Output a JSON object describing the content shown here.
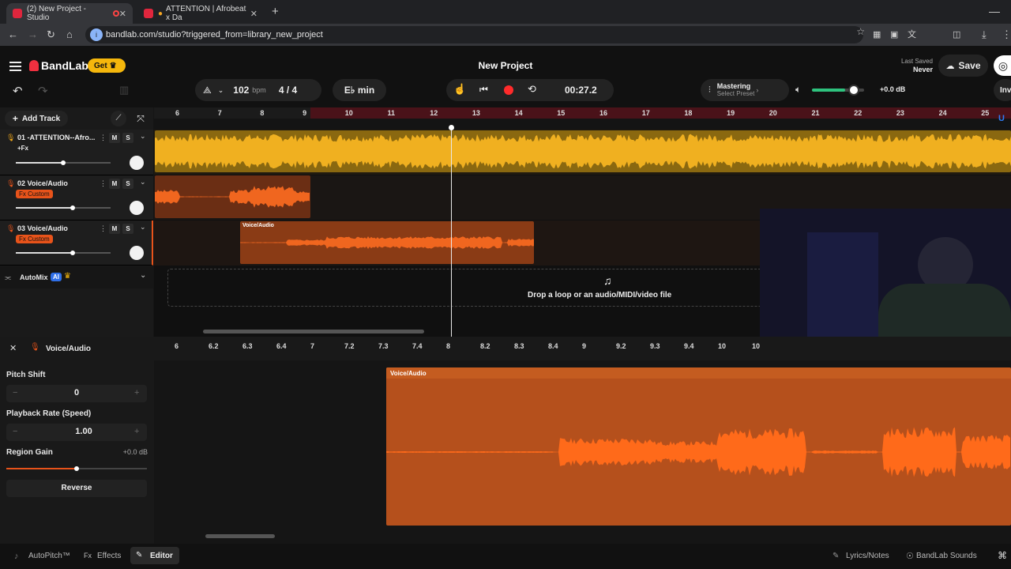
{
  "browser": {
    "tabs": [
      {
        "title": "(2) New Project - Studio",
        "active": true
      },
      {
        "title": "ATTENTION | Afrobeat x Da",
        "active": false
      }
    ],
    "new_tab": "+",
    "url": "bandlab.com/studio?triggered_from=library_new_project"
  },
  "app": {
    "brand": "BandLab",
    "get_label": "Get",
    "project_title": "New Project",
    "last_saved_label": "Last Saved",
    "last_saved_value": "Never",
    "save_label": "Save"
  },
  "transport": {
    "bpm_value": "102",
    "bpm_unit": "bpm",
    "time_signature": "4 / 4",
    "key": "E♭ min",
    "time": "00:27.2",
    "mastering_label": "Mastering",
    "mastering_preset": "Select Preset",
    "volume_db": "+0.0 dB",
    "volume_level": 0.8,
    "invite_label": "Inv"
  },
  "add_track_label": "Add Track",
  "ruler_ticks": [
    "6",
    "7",
    "8",
    "9",
    "10",
    "11",
    "12",
    "13",
    "14",
    "15",
    "16",
    "17",
    "18",
    "19",
    "20",
    "21",
    "22",
    "23",
    "24",
    "25"
  ],
  "tracks": [
    {
      "name": "01 -ATTENTION--Afro...",
      "fx": "+Fx",
      "fx_custom": false,
      "color": "#f0a81a",
      "volume": 0.5
    },
    {
      "name": "02 Voice/Audio",
      "fx": "Fx Custom",
      "fx_custom": true,
      "color": "#e8531a",
      "volume": 0.6
    },
    {
      "name": "03 Voice/Audio",
      "fx": "Fx Custom",
      "fx_custom": true,
      "color": "#e8531a",
      "volume": 0.6
    }
  ],
  "mute_label": "M",
  "solo_label": "S",
  "clip_label": "Voice/Audio",
  "automix_label": "AutoMix",
  "ai_badge": "AI",
  "drop_text": "Drop a loop or an audio/MIDI/video file",
  "editor": {
    "track_name": "Voice/Audio",
    "ruler_ticks": [
      "6",
      "6.2",
      "6.3",
      "6.4",
      "7",
      "7.2",
      "7.3",
      "7.4",
      "8",
      "8.2",
      "8.3",
      "8.4",
      "9",
      "9.2",
      "9.3",
      "9.4",
      "10",
      "10"
    ],
    "pitch_shift_label": "Pitch Shift",
    "pitch_shift_value": "0",
    "playback_rate_label": "Playback Rate (Speed)",
    "playback_rate_value": "1.00",
    "region_gain_label": "Region Gain",
    "region_gain_value": "+0.0 dB",
    "reverse_label": "Reverse",
    "minus": "−",
    "plus": "+"
  },
  "bottom_tabs": {
    "autopitch": "AutoPitch™",
    "effects": "Effects",
    "editor": "Editor",
    "lyrics": "Lyrics/Notes",
    "sounds": "BandLab Sounds"
  },
  "colors": {
    "accent_orange": "#e8531a",
    "accent_yellow": "#f0a81a",
    "brand_red": "#f0303f",
    "record": "#ff2b2b"
  }
}
